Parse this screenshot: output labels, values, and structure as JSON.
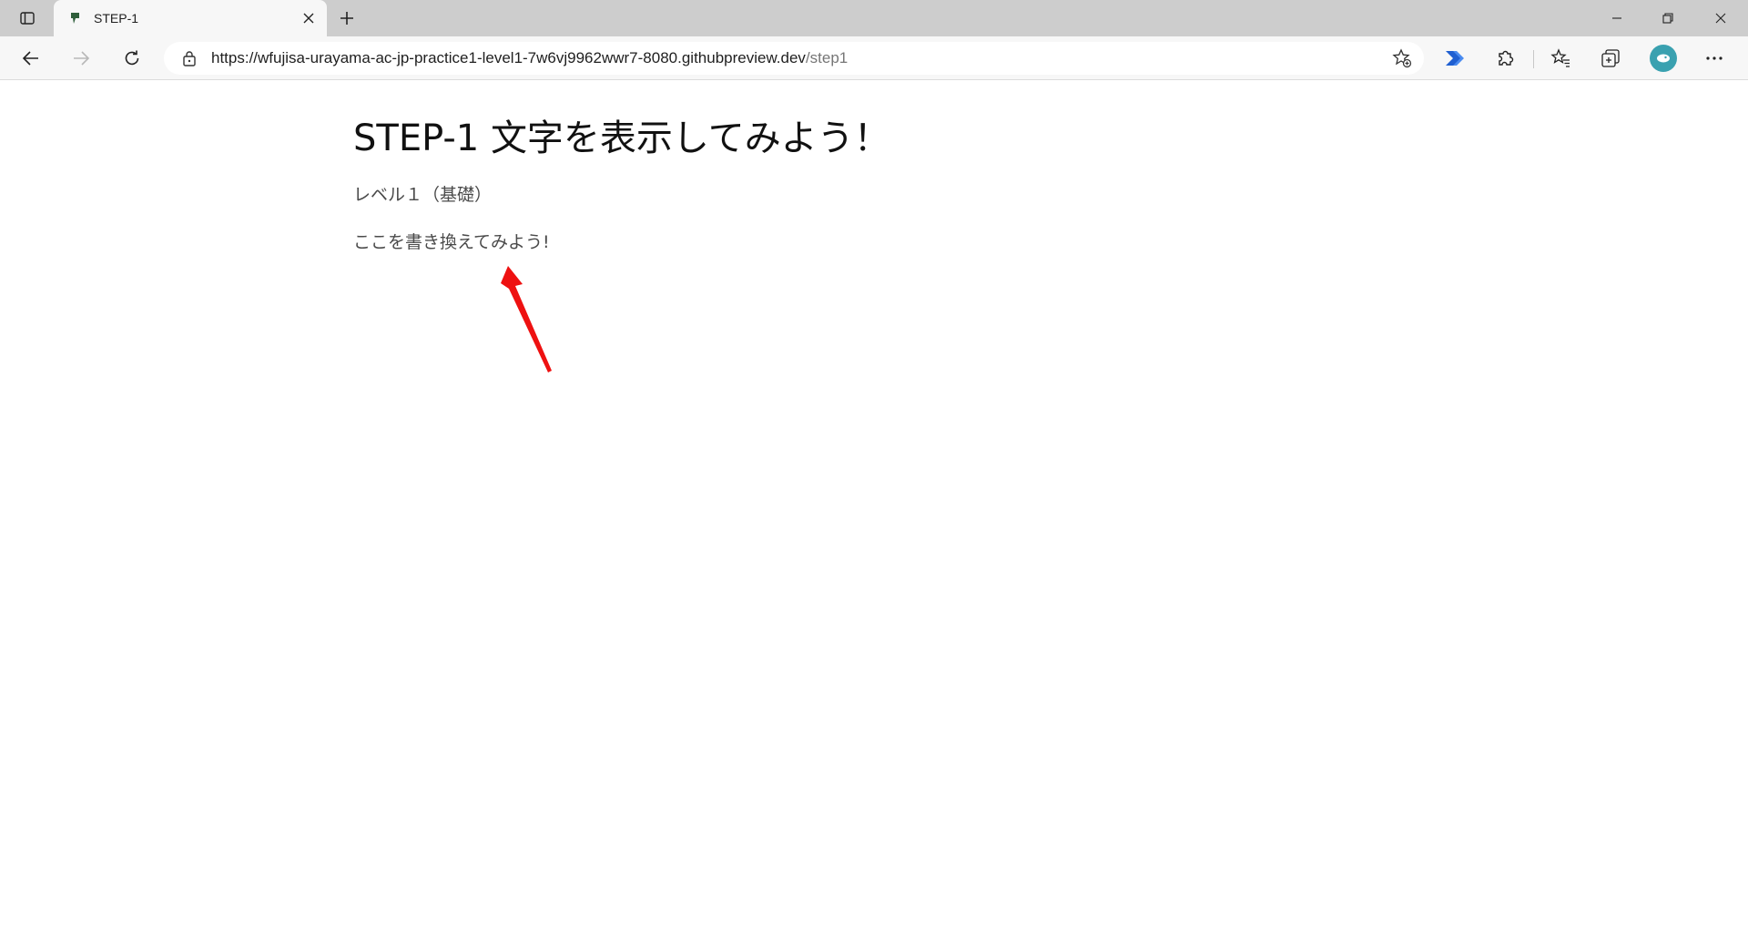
{
  "browser": {
    "tab": {
      "title": "STEP-1"
    },
    "address_bar": {
      "url_host": "https://wfujisa-urayama-ac-jp-practice1-level1-7w6vj9962wwr7-8080.githubpreview.dev",
      "url_path": "/step1"
    },
    "icons": {
      "tab_actions": "tab-actions-icon",
      "favicon": "favicon-icon",
      "tab_close": "close-icon",
      "new_tab": "plus-icon",
      "minimize": "minimize-icon",
      "restore": "restore-icon",
      "close_window": "close-icon",
      "back": "back-arrow-icon",
      "forward": "forward-arrow-icon",
      "reload": "reload-icon",
      "lock": "lock-icon",
      "add_favorite": "add-favorite-icon",
      "extension_power_automate": "power-automate-icon",
      "extensions": "extensions-puzzle-icon",
      "favorites": "favorites-icon",
      "collections": "collections-icon",
      "profile": "profile-avatar-icon",
      "more": "more-dots-icon"
    },
    "colors": {
      "tabstrip": "#cdcdcd",
      "toolbar": "#f7f7f7",
      "avatar": "#3aa1b0",
      "annotation_arrow": "#ee1111"
    }
  },
  "page": {
    "title": "STEP-1 文字を表示してみよう！",
    "level": "レベル１（基礎）",
    "message": "ここを書き換えてみよう!"
  }
}
